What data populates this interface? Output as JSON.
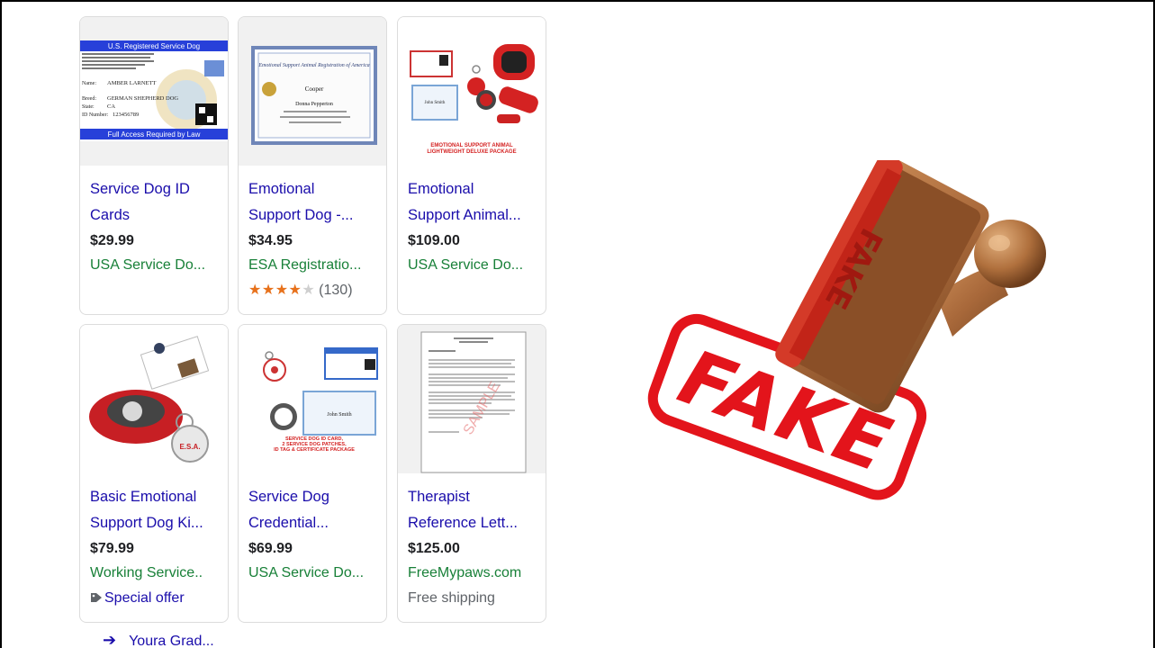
{
  "products": [
    {
      "title": "Service Dog ID\nCards",
      "price": "$29.99",
      "merchant": "USA Service Do...",
      "thumb": {
        "header": "U.S. Registered Service Dog",
        "footer": "Full Access Required by Law",
        "name": "AMBER LARNETT",
        "breed": "GERMAN SHEPHERD DOG",
        "state": "CA",
        "id": "123456789"
      }
    },
    {
      "title": "Emotional\nSupport Dog -...",
      "price": "$34.95",
      "merchant": "ESA Registratio...",
      "rating": {
        "stars": "★★★★",
        "empty": "★",
        "count": "(130)"
      },
      "thumb": {
        "heading": "Emotional Support Animal Registration of America",
        "name": "Cooper",
        "owner": "Donna Pepperton"
      }
    },
    {
      "title": "Emotional\nSupport Animal...",
      "price": "$109.00",
      "merchant": "USA Service Do...",
      "thumb": {
        "caption1": "EMOTIONAL SUPPORT ANIMAL",
        "caption2": "LIGHTWEIGHT DELUXE PACKAGE",
        "cert_name": "John Smith"
      }
    },
    {
      "title": "Basic Emotional\nSupport Dog Ki...",
      "price": "$79.99",
      "merchant": "Working Service..",
      "offer": "Special offer",
      "thumb": {
        "vest_label": "E.S.A."
      }
    },
    {
      "title": "Service Dog\nCredential...",
      "price": "$69.99",
      "merchant": "USA Service Do...",
      "thumb": {
        "caption1": "SERVICE DOG ID CARD,",
        "caption2": "2 SERVICE DOG PATCHES,",
        "caption3": "ID TAG & CERTIFICATE PACKAGE",
        "cert_name": "John Smith"
      }
    },
    {
      "title": "Therapist\nReference Lett...",
      "price": "$125.00",
      "merchant": "FreeMypaws.com",
      "shipping": "Free shipping",
      "thumb": {
        "watermark": "SAMPLE"
      }
    }
  ],
  "more_link": "Youra Grad...",
  "stamp": {
    "word": "FAKE"
  },
  "colors": {
    "link": "#1a0dab",
    "merchant": "#188038",
    "star": "#e7711b",
    "stamp_red": "#e3141b"
  }
}
